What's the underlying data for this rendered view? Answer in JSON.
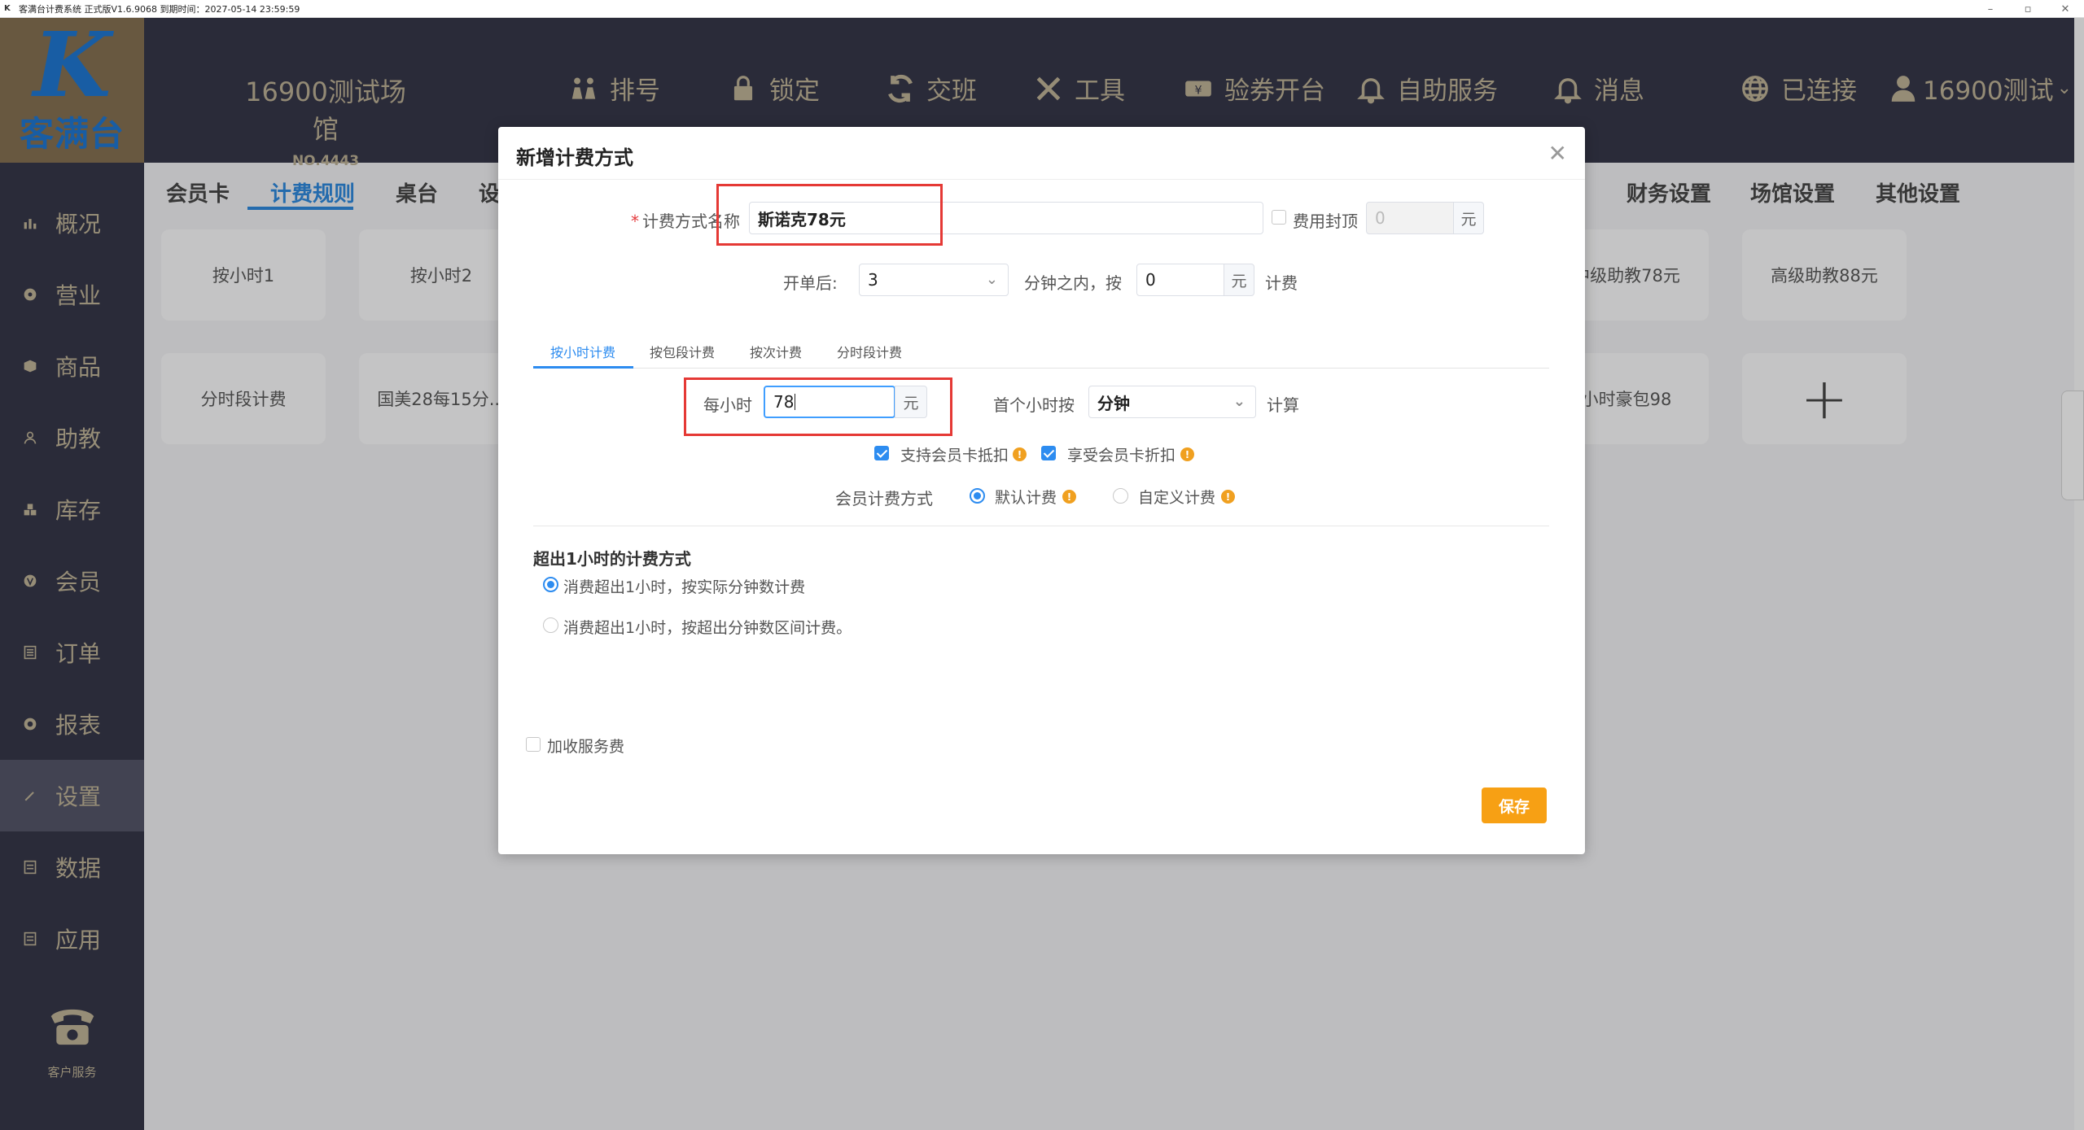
{
  "window": {
    "title": "客满台计费系统 正式版V1.6.9068 到期时间：2027-05-14 23:59:59",
    "controls": [
      "–",
      "▫",
      "✕"
    ]
  },
  "header": {
    "logo_text": "客满台",
    "venue_name": "16900测试场馆",
    "venue_no": "NO.4443",
    "nav": [
      {
        "label": "排号",
        "icon": "people-icon"
      },
      {
        "label": "锁定",
        "icon": "lock-icon"
      },
      {
        "label": "交班",
        "icon": "refresh-icon"
      },
      {
        "label": "工具",
        "icon": "tools-icon"
      },
      {
        "label": "验券开台",
        "icon": "ticket-icon"
      },
      {
        "label": "自助服务",
        "icon": "bell-icon"
      },
      {
        "label": "消息",
        "icon": "bell-icon"
      },
      {
        "label": "已连接",
        "icon": "globe-icon"
      },
      {
        "label": "16900测试",
        "icon": "user-icon"
      }
    ]
  },
  "sidebar": {
    "items": [
      {
        "label": "概况"
      },
      {
        "label": "营业"
      },
      {
        "label": "商品"
      },
      {
        "label": "助教"
      },
      {
        "label": "库存"
      },
      {
        "label": "会员"
      },
      {
        "label": "订单"
      },
      {
        "label": "报表"
      },
      {
        "label": "设置"
      },
      {
        "label": "数据"
      },
      {
        "label": "应用"
      }
    ],
    "service_label": "客户服务"
  },
  "content": {
    "tabs": [
      "会员卡",
      "计费规则",
      "桌台",
      "设",
      "财务设置",
      "场馆设置",
      "其他设置"
    ],
    "cards_row1": [
      "按小时1",
      "按小时2",
      "中级助教78元",
      "高级助教88元"
    ],
    "cards_row2": [
      "分时段计费",
      "国美28每15分...",
      "小时豪包98"
    ]
  },
  "dialog": {
    "title": "新增计费方式",
    "name_label": "计费方式名称",
    "name_value": "斯诺克78元",
    "cap_label": "费用封顶",
    "cap_placeholder": "0",
    "unit_yuan": "元",
    "open_label": "开单后:",
    "open_minutes": "3",
    "within_text": "分钟之内，按",
    "within_value": "0",
    "charge_text": "计费",
    "subtabs": [
      "按小时计费",
      "按包段计费",
      "按次计费",
      "分时段计费"
    ],
    "per_hour_label": "每小时",
    "per_hour_value": "78",
    "first_hour_label": "首个小时按",
    "first_hour_select": "分钟",
    "calc_text": "计算",
    "support_member_deduct": "支持会员卡抵扣",
    "enjoy_member_discount": "享受会员卡折扣",
    "member_billing_label": "会员计费方式",
    "member_default": "默认计费",
    "member_custom": "自定义计费",
    "exceed_title": "超出1小时的计费方式",
    "exceed_opt1": "消费超出1小时，按实际分钟数计费",
    "exceed_opt2": "消费超出1小时，按超出分钟数区间计费。",
    "service_fee": "加收服务费",
    "save": "保存"
  }
}
